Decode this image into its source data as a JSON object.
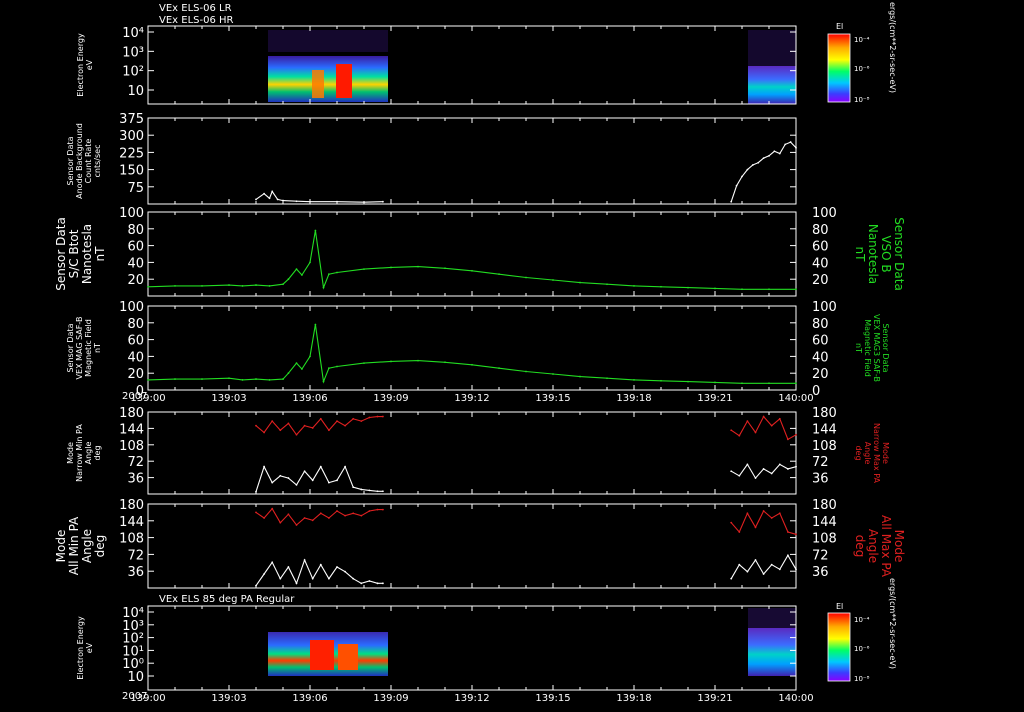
{
  "header": {
    "line1": "VEx ELS-06 LR",
    "line2": "VEx ELS-06 HR"
  },
  "footer_title": "VEx ELS 85 deg PA Regular",
  "year": "2007",
  "time_ticks": [
    "139:00",
    "139:03",
    "139:06",
    "139:09",
    "139:12",
    "139:15",
    "139:18",
    "139:21",
    "140:00"
  ],
  "colorbar": {
    "label": "El",
    "ticks": [
      "10⁻⁴",
      "10⁻⁶",
      "10⁻⁸"
    ],
    "unit": "ergs/(cm**2-sr-sec-eV)"
  },
  "colors": {
    "background": "#000000",
    "axes": "#ffffff",
    "green": "#22dd22",
    "red": "#e02020",
    "white": "#ffffff"
  },
  "chart_data": [
    {
      "type": "heatmap",
      "id": "p1",
      "ylabel": [
        "Electron Energy",
        "eV"
      ],
      "yscale": "log",
      "ytick_labels": [
        "10⁴",
        "10³",
        "10²",
        "10"
      ],
      "blocks": [
        {
          "t_start": "139:04.0",
          "t_end": "139:08.7",
          "intensity": "high"
        },
        {
          "t_start": "139:21.6",
          "t_end": "139:22.7",
          "intensity": "medium"
        }
      ]
    },
    {
      "type": "line",
      "id": "p2",
      "ylabel": [
        "Sensor Data",
        "Anode Background",
        "Count Rate",
        "cnts/sec"
      ],
      "ylim": [
        0,
        375
      ],
      "ytick_labels": [
        "375",
        "300",
        "225",
        "150",
        "75"
      ],
      "series": [
        {
          "color": "white",
          "x": [
            4.0,
            4.3,
            4.5,
            4.6,
            4.8,
            5.0,
            5.5,
            6.0,
            7.0,
            8.0,
            8.7
          ],
          "y": [
            20,
            45,
            25,
            55,
            20,
            15,
            12,
            10,
            10,
            8,
            10
          ]
        },
        {
          "color": "white",
          "x": [
            21.6,
            21.8,
            22.0,
            22.2,
            22.4,
            22.6,
            22.8,
            23.0,
            23.2,
            23.4,
            23.6,
            23.8,
            24.0
          ],
          "y": [
            10,
            80,
            120,
            150,
            170,
            180,
            200,
            210,
            230,
            220,
            260,
            270,
            245
          ]
        }
      ]
    },
    {
      "type": "line",
      "id": "p3",
      "ylabel": [
        "Sensor Data",
        "S/C Btot",
        "Nanotesla",
        "nT"
      ],
      "right_label": [
        "Sensor Data",
        "VSO B",
        "Nanotesla",
        "nT"
      ],
      "ylim": [
        0,
        100
      ],
      "ytick_labels": [
        "100",
        "80",
        "60",
        "40",
        "20"
      ],
      "series": [
        {
          "color": "green",
          "x": [
            0,
            1,
            2,
            3,
            3.5,
            4,
            4.5,
            5,
            5.2,
            5.5,
            5.7,
            6.0,
            6.2,
            6.5,
            6.7,
            7,
            8,
            9,
            10,
            11,
            12,
            13,
            14,
            15,
            16,
            17,
            18,
            19,
            20,
            21,
            22,
            23,
            24
          ],
          "y": [
            11,
            12,
            12,
            13,
            12,
            13,
            12,
            14,
            20,
            32,
            25,
            40,
            78,
            10,
            26,
            28,
            32,
            34,
            35,
            33,
            30,
            26,
            22,
            19,
            16,
            14,
            12,
            11,
            10,
            9,
            8,
            8,
            8
          ]
        }
      ]
    },
    {
      "type": "line",
      "id": "p4",
      "ylabel": [
        "Sensor Data",
        "VEX MAG SAF-B",
        "Magnetic Field",
        "nT"
      ],
      "right_label": [
        "Sensor Data",
        "VEX MAG3 SAF-B",
        "Magnetic Field",
        "nT"
      ],
      "ylim": [
        0,
        100
      ],
      "ytick_labels": [
        "100",
        "80",
        "60",
        "40",
        "20",
        "0"
      ],
      "series": [
        {
          "color": "green",
          "x": [
            0,
            1,
            2,
            3,
            3.5,
            4,
            4.5,
            5,
            5.2,
            5.5,
            5.7,
            6.0,
            6.2,
            6.5,
            6.7,
            7,
            8,
            9,
            10,
            11,
            12,
            13,
            14,
            15,
            16,
            17,
            18,
            19,
            20,
            21,
            22,
            23,
            24
          ],
          "y": [
            12,
            13,
            13,
            14,
            12,
            13,
            12,
            13,
            20,
            32,
            25,
            40,
            78,
            10,
            26,
            28,
            32,
            34,
            35,
            33,
            30,
            26,
            22,
            19,
            16,
            14,
            12,
            11,
            10,
            9,
            8,
            8,
            8
          ]
        }
      ]
    },
    {
      "type": "line",
      "id": "p5",
      "ylabel": [
        "Mode",
        "Narrow Min PA",
        "Angle",
        "deg"
      ],
      "right_label": [
        "Mode",
        "Narrow Max PA",
        "Angle",
        "deg"
      ],
      "ylim": [
        0,
        180
      ],
      "ytick_labels": [
        "180",
        "144",
        "108",
        "72",
        "36"
      ],
      "series": [
        {
          "color": "red",
          "x": [
            4.0,
            4.3,
            4.6,
            4.9,
            5.2,
            5.5,
            5.8,
            6.1,
            6.4,
            6.7,
            7.0,
            7.3,
            7.6,
            7.9,
            8.2,
            8.5,
            8.7
          ],
          "y": [
            150,
            135,
            160,
            140,
            155,
            130,
            150,
            145,
            165,
            140,
            160,
            150,
            165,
            160,
            168,
            170,
            170
          ]
        },
        {
          "color": "white",
          "x": [
            4.0,
            4.3,
            4.6,
            4.9,
            5.2,
            5.5,
            5.8,
            6.1,
            6.4,
            6.7,
            7.0,
            7.3,
            7.6,
            7.9,
            8.2,
            8.5,
            8.7
          ],
          "y": [
            5,
            60,
            25,
            40,
            35,
            20,
            50,
            30,
            60,
            25,
            30,
            60,
            15,
            10,
            8,
            6,
            6
          ]
        },
        {
          "color": "red",
          "x": [
            21.6,
            21.9,
            22.2,
            22.5,
            22.8,
            23.1,
            23.4,
            23.7,
            24.0
          ],
          "y": [
            140,
            128,
            160,
            135,
            170,
            150,
            165,
            120,
            130
          ]
        },
        {
          "color": "white",
          "x": [
            21.6,
            21.9,
            22.2,
            22.5,
            22.8,
            23.1,
            23.4,
            23.7,
            24.0
          ],
          "y": [
            50,
            40,
            65,
            35,
            55,
            45,
            65,
            55,
            60
          ]
        }
      ]
    },
    {
      "type": "line",
      "id": "p6",
      "ylabel": [
        "Mode",
        "All Min PA",
        "Angle",
        "deg"
      ],
      "right_label": [
        "Mode",
        "All Max PA",
        "Angle",
        "deg"
      ],
      "ylim": [
        0,
        180
      ],
      "ytick_labels": [
        "180",
        "144",
        "108",
        "72",
        "36"
      ],
      "series": [
        {
          "color": "red",
          "x": [
            4.0,
            4.3,
            4.6,
            4.9,
            5.2,
            5.5,
            5.8,
            6.1,
            6.4,
            6.7,
            7.0,
            7.3,
            7.6,
            7.9,
            8.2,
            8.5,
            8.7
          ],
          "y": [
            162,
            150,
            170,
            140,
            158,
            135,
            150,
            145,
            160,
            150,
            165,
            155,
            160,
            155,
            165,
            168,
            168
          ]
        },
        {
          "color": "white",
          "x": [
            4.0,
            4.3,
            4.6,
            4.9,
            5.2,
            5.5,
            5.8,
            6.1,
            6.4,
            6.7,
            7.0,
            7.3,
            7.6,
            7.9,
            8.2,
            8.5,
            8.7
          ],
          "y": [
            5,
            30,
            55,
            20,
            45,
            10,
            60,
            20,
            50,
            20,
            45,
            35,
            20,
            10,
            15,
            10,
            10
          ]
        },
        {
          "color": "red",
          "x": [
            21.6,
            21.9,
            22.2,
            22.5,
            22.8,
            23.1,
            23.4,
            23.7,
            24.0
          ],
          "y": [
            140,
            120,
            160,
            130,
            165,
            150,
            160,
            120,
            115
          ]
        },
        {
          "color": "white",
          "x": [
            21.6,
            21.9,
            22.2,
            22.5,
            22.8,
            23.1,
            23.4,
            23.7,
            24.0
          ],
          "y": [
            20,
            50,
            35,
            60,
            30,
            50,
            40,
            70,
            40
          ]
        }
      ]
    },
    {
      "type": "heatmap",
      "id": "p7",
      "ylabel": [
        "Electron Energy",
        "eV"
      ],
      "yscale": "log",
      "ytick_labels": [
        "10⁴",
        "10³",
        "10²",
        "10¹",
        "10⁰",
        "10"
      ],
      "blocks": [
        {
          "t_start": "139:04.0",
          "t_end": "139:08.7",
          "intensity": "high"
        },
        {
          "t_start": "139:21.6",
          "t_end": "139:22.7",
          "intensity": "medium"
        }
      ]
    }
  ]
}
